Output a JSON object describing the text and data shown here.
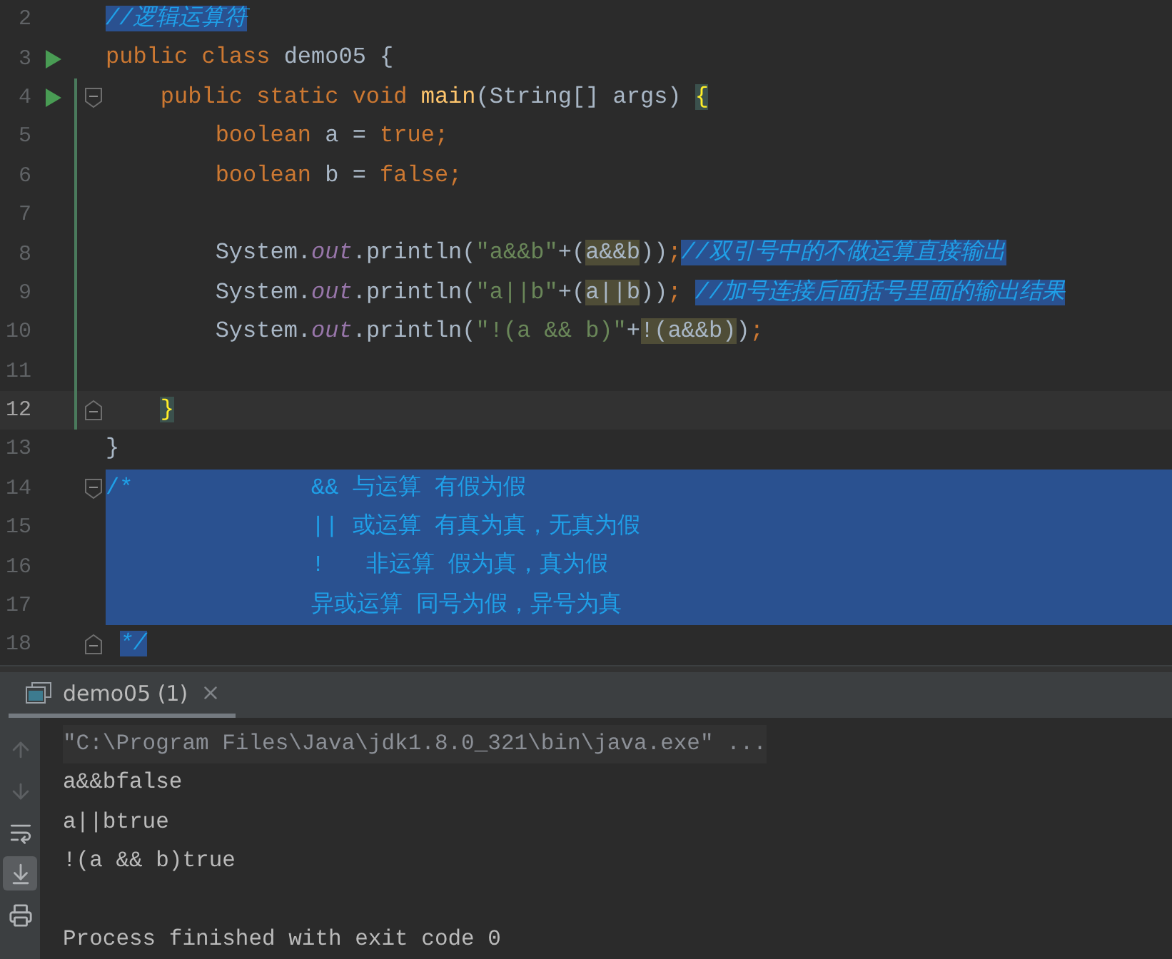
{
  "editor": {
    "lines": [
      {
        "number": "2",
        "current": false,
        "selected": false,
        "tokens": [
          {
            "text": "//逻辑运算符",
            "kind": "comment",
            "selected": true
          }
        ]
      },
      {
        "number": "3",
        "run": true,
        "current": false,
        "selected": false,
        "tokens": [
          {
            "text": "public class ",
            "kind": "keyword",
            "selected": false
          },
          {
            "text": "demo05 {",
            "kind": "plain",
            "selected": false
          }
        ]
      },
      {
        "number": "4",
        "run": true,
        "fold": {
          "kind": "start"
        },
        "changed": true,
        "current": false,
        "selected": false,
        "tokens": [
          {
            "text": "    public static void ",
            "kind": "keyword",
            "selected": false
          },
          {
            "text": "main",
            "kind": "method",
            "selected": false
          },
          {
            "text": "(String[] args) ",
            "kind": "plain",
            "selected": false
          },
          {
            "text": "{",
            "kind": "brace_match",
            "selected": false
          }
        ]
      },
      {
        "number": "5",
        "changed": true,
        "current": false,
        "selected": false,
        "tokens": [
          {
            "text": "        boolean ",
            "kind": "keyword",
            "selected": false
          },
          {
            "text": "a = ",
            "kind": "plain",
            "selected": false
          },
          {
            "text": "true;",
            "kind": "keyword",
            "selected": false
          }
        ]
      },
      {
        "number": "6",
        "changed": true,
        "current": false,
        "selected": false,
        "tokens": [
          {
            "text": "        boolean ",
            "kind": "keyword",
            "selected": false
          },
          {
            "text": "b = ",
            "kind": "plain",
            "selected": false
          },
          {
            "text": "false;",
            "kind": "keyword",
            "selected": false
          }
        ]
      },
      {
        "number": "7",
        "changed": true,
        "current": false,
        "selected": false
      },
      {
        "number": "8",
        "changed": true,
        "current": false,
        "selected": false,
        "tokens": [
          {
            "text": "        System.",
            "kind": "plain",
            "selected": false
          },
          {
            "text": "out",
            "kind": "field",
            "selected": false
          },
          {
            "text": ".println(",
            "kind": "plain",
            "selected": false
          },
          {
            "text": "\"a&&b\"",
            "kind": "string",
            "selected": false
          },
          {
            "text": "+(",
            "kind": "plain",
            "selected": false
          },
          {
            "text": "a&&b",
            "kind": "match",
            "selected": false
          },
          {
            "text": "))",
            "kind": "plain",
            "selected": false
          },
          {
            "text": ";",
            "kind": "keyword",
            "selected": false
          },
          {
            "text": "//双引号中的不做运算直接输出",
            "kind": "comment",
            "selected": true
          }
        ]
      },
      {
        "number": "9",
        "changed": true,
        "current": false,
        "selected": false,
        "tokens": [
          {
            "text": "        System.",
            "kind": "plain",
            "selected": false
          },
          {
            "text": "out",
            "kind": "field",
            "selected": false
          },
          {
            "text": ".println(",
            "kind": "plain",
            "selected": false
          },
          {
            "text": "\"a||b\"",
            "kind": "string",
            "selected": false
          },
          {
            "text": "+(",
            "kind": "plain",
            "selected": false
          },
          {
            "text": "a||b",
            "kind": "match",
            "selected": false
          },
          {
            "text": "))",
            "kind": "plain",
            "selected": false
          },
          {
            "text": "; ",
            "kind": "keyword",
            "selected": false
          },
          {
            "text": "//加号连接后面括号里面的输出结果",
            "kind": "comment",
            "selected": true
          }
        ]
      },
      {
        "number": "10",
        "changed": true,
        "current": false,
        "selected": false,
        "tokens": [
          {
            "text": "        System.",
            "kind": "plain",
            "selected": false
          },
          {
            "text": "out",
            "kind": "field",
            "selected": false
          },
          {
            "text": ".println(",
            "kind": "plain",
            "selected": false
          },
          {
            "text": "\"!(a && b)\"",
            "kind": "string",
            "selected": false
          },
          {
            "text": "+",
            "kind": "plain",
            "selected": false
          },
          {
            "text": "!(a&&b)",
            "kind": "match",
            "selected": false
          },
          {
            "text": ")",
            "kind": "plain",
            "selected": false
          },
          {
            "text": ";",
            "kind": "keyword",
            "selected": false
          }
        ]
      },
      {
        "number": "11",
        "changed": true,
        "current": false,
        "selected": false
      },
      {
        "number": "12",
        "fold": {
          "kind": "end"
        },
        "changed": true,
        "current": true,
        "selected": false,
        "tokens": [
          {
            "text": "    }",
            "kind": "brace_match",
            "selected": false
          }
        ]
      },
      {
        "number": "13",
        "current": false,
        "selected": false,
        "tokens": [
          {
            "text": "}",
            "kind": "plain",
            "selected": false
          }
        ]
      },
      {
        "number": "14",
        "fold": {
          "kind": "start"
        },
        "current": false,
        "selected": true,
        "tokens": [
          {
            "text": "/*             && 与运算 有假为假",
            "kind": "comment"
          }
        ]
      },
      {
        "number": "15",
        "current": false,
        "selected": true,
        "tokens": [
          {
            "text": "               || 或运算 有真为真，无真为假",
            "kind": "comment"
          }
        ]
      },
      {
        "number": "16",
        "current": false,
        "selected": true,
        "tokens": [
          {
            "text": "               !   非运算 假为真，真为假",
            "kind": "comment"
          }
        ]
      },
      {
        "number": "17",
        "current": false,
        "selected": true,
        "tokens": [
          {
            "text": "               异或运算 同号为假，异号为真",
            "kind": "comment"
          }
        ]
      },
      {
        "number": "18",
        "fold": {
          "kind": "end"
        },
        "current": false,
        "selected": false,
        "tokens": [
          {
            "text": " */",
            "kind": "comment",
            "selected": true
          }
        ]
      }
    ]
  },
  "console": {
    "tab": {
      "title": "demo05 (1)",
      "selected": true
    },
    "tools": [
      {
        "kind": "up",
        "disabled": true,
        "on": false
      },
      {
        "kind": "down",
        "disabled": true,
        "on": false
      },
      {
        "kind": "wrap",
        "disabled": false,
        "on": false
      },
      {
        "kind": "scroll_end",
        "disabled": false,
        "on": true
      },
      {
        "kind": "print",
        "disabled": false,
        "on": false
      }
    ],
    "lines": [
      {
        "text": "\"C:\\Program Files\\Java\\jdk1.8.0_321\\bin\\java.exe\" ...",
        "kind": "command"
      },
      {
        "text": "a&&bfalse",
        "kind": "output"
      },
      {
        "text": "a||btrue",
        "kind": "output"
      },
      {
        "text": "!(a && b)true",
        "kind": "output"
      },
      {
        "text": "Process finished with exit code 0",
        "kind": "status"
      }
    ]
  }
}
